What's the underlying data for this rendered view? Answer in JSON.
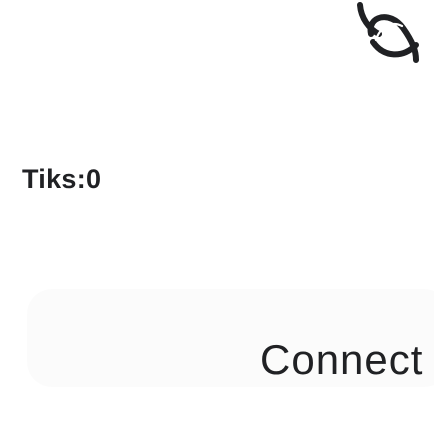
{
  "ticks": {
    "label": "Tiks:0"
  },
  "connect": {
    "label": "Connect"
  },
  "icons": {
    "spinner": "loading-spinner-icon"
  }
}
